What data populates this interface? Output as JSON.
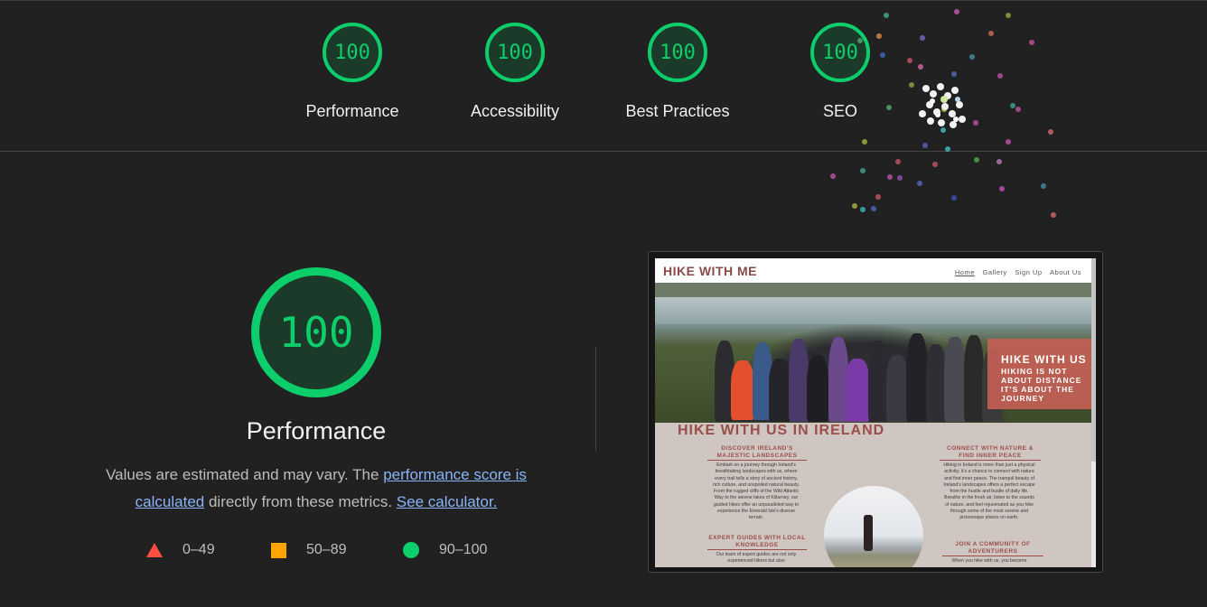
{
  "summary_gauges": [
    {
      "score": "100",
      "label": "Performance"
    },
    {
      "score": "100",
      "label": "Accessibility"
    },
    {
      "score": "100",
      "label": "Best Practices"
    },
    {
      "score": "100",
      "label": "SEO"
    }
  ],
  "performance": {
    "score": "100",
    "title": "Performance",
    "desc_before": "Values are estimated and may vary. The ",
    "desc_link1": "performance score is calculated",
    "desc_middle": " directly from these metrics. ",
    "desc_link2": "See calculator."
  },
  "legend": [
    {
      "range": "0–49",
      "color": "#ff4e42"
    },
    {
      "range": "50–89",
      "color": "#ffa400"
    },
    {
      "range": "90–100",
      "color": "#0cce6b"
    }
  ],
  "screenshot": {
    "logo": "HIKE WITH ME",
    "nav": [
      "Home",
      "Gallery",
      "Sign Up",
      "About Us"
    ],
    "hero_box_title": "HIKE WITH US",
    "hero_box_text": "HIKING IS NOT ABOUT DISTANCE IT'S ABOUT THE JOURNEY",
    "section_title": "HIKE WITH US IN IRELAND",
    "col1_head": "DISCOVER IRELAND'S MAJESTIC LANDSCAPES",
    "col1_text": "Embark on a journey through Ireland's breathtaking landscapes with us, where every trail tells a story of ancient history, rich culture, and unspoiled natural beauty. From the rugged cliffs of the Wild Atlantic Way to the serene lakes of Killarney, our guided hikes offer an unparalleled way to experience the Emerald Isle's diverse terrain.",
    "col1b_head": "EXPERT GUIDES WITH LOCAL KNOWLEDGE",
    "col1b_text": "Our team of expert guides are not only experienced hikers but also",
    "col2_head": "CONNECT WITH NATURE & FIND INNER PEACE",
    "col2_text": "Hiking in Ireland is more than just a physical activity; it's a chance to connect with nature and find inner peace. The tranquil beauty of Ireland's landscapes offers a perfect escape from the hustle and bustle of daily life. Breathe in the fresh air, listen to the sounds of nature, and feel rejuvenated as you hike through some of the most serene and picturesque places on earth.",
    "col2b_head": "JOIN A COMMUNITY OF ADVENTURERS",
    "col2b_text": "When you hike with us, you become"
  },
  "colors": {
    "pass": "#0cce6b",
    "average": "#ffa400",
    "fail": "#ff4e42",
    "link": "#8ab4f8",
    "background": "#212121"
  }
}
